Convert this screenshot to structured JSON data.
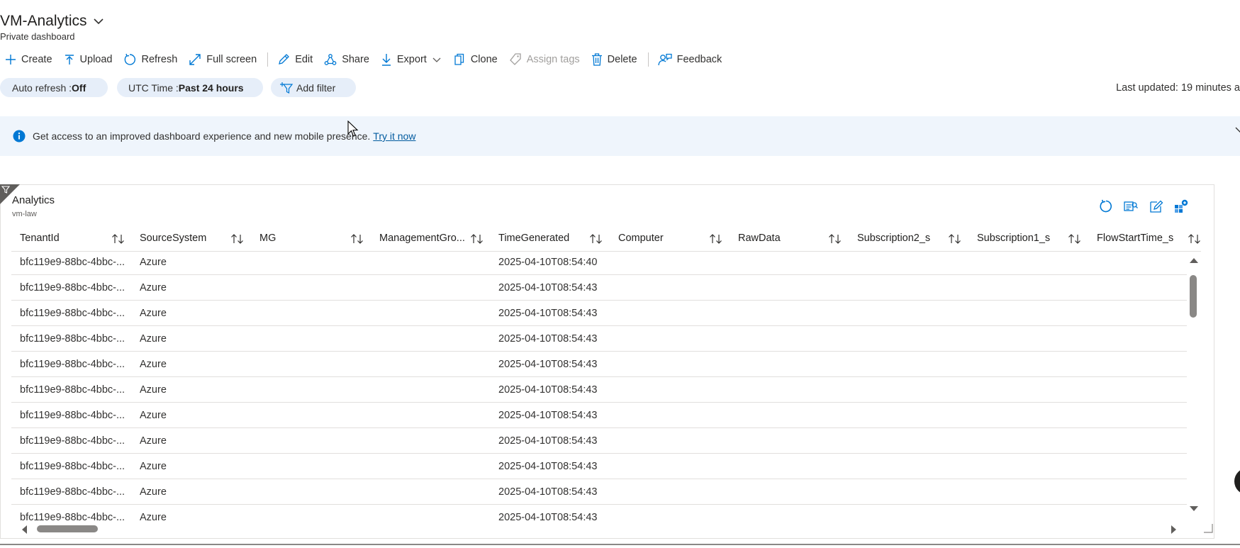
{
  "header": {
    "title": "VM-Analytics",
    "subtitle": "Private dashboard"
  },
  "toolbar": {
    "create": "Create",
    "upload": "Upload",
    "refresh": "Refresh",
    "full_screen": "Full screen",
    "edit": "Edit",
    "share": "Share",
    "export": "Export",
    "clone": "Clone",
    "assign_tags": "Assign tags",
    "delete": "Delete",
    "feedback": "Feedback"
  },
  "filters": {
    "auto_refresh_label": "Auto refresh : ",
    "auto_refresh_value": "Off",
    "time_label": "UTC Time : ",
    "time_value": "Past 24 hours",
    "add_filter": "Add filter",
    "last_updated": "Last updated: 19 minutes a"
  },
  "banner": {
    "message": "Get access to an improved dashboard experience and new mobile presence.",
    "link": "Try it now"
  },
  "tile": {
    "title": "Analytics",
    "subtitle": "vm-law"
  },
  "table": {
    "columns": [
      "TenantId",
      "SourceSystem",
      "MG",
      "ManagementGro...",
      "TimeGenerated",
      "Computer",
      "RawData",
      "Subscription2_s",
      "Subscription1_s",
      "FlowStartTime_s"
    ],
    "rows": [
      {
        "tenant": "bfc119e9-88bc-4bbc-...",
        "source": "Azure",
        "time": "2025-04-10T08:54:40"
      },
      {
        "tenant": "bfc119e9-88bc-4bbc-...",
        "source": "Azure",
        "time": "2025-04-10T08:54:43"
      },
      {
        "tenant": "bfc119e9-88bc-4bbc-...",
        "source": "Azure",
        "time": "2025-04-10T08:54:43"
      },
      {
        "tenant": "bfc119e9-88bc-4bbc-...",
        "source": "Azure",
        "time": "2025-04-10T08:54:43"
      },
      {
        "tenant": "bfc119e9-88bc-4bbc-...",
        "source": "Azure",
        "time": "2025-04-10T08:54:43"
      },
      {
        "tenant": "bfc119e9-88bc-4bbc-...",
        "source": "Azure",
        "time": "2025-04-10T08:54:43"
      },
      {
        "tenant": "bfc119e9-88bc-4bbc-...",
        "source": "Azure",
        "time": "2025-04-10T08:54:43"
      },
      {
        "tenant": "bfc119e9-88bc-4bbc-...",
        "source": "Azure",
        "time": "2025-04-10T08:54:43"
      },
      {
        "tenant": "bfc119e9-88bc-4bbc-...",
        "source": "Azure",
        "time": "2025-04-10T08:54:43"
      },
      {
        "tenant": "bfc119e9-88bc-4bbc-...",
        "source": "Azure",
        "time": "2025-04-10T08:54:43"
      },
      {
        "tenant": "bfc119e9-88bc-4bbc-...",
        "source": "Azure",
        "time": "2025-04-10T08:54:43"
      }
    ]
  },
  "colors": {
    "accent": "#0078d4",
    "pill_bg": "#e6eef9",
    "banner_bg": "#eff5fc"
  },
  "icons": [
    "chevron-down-icon",
    "plus-icon",
    "upload-icon",
    "refresh-icon",
    "full-screen-icon",
    "edit-icon",
    "share-icon",
    "export-icon",
    "clone-icon",
    "tag-icon",
    "delete-icon",
    "feedback-icon",
    "add-filter-icon",
    "info-icon",
    "close-icon",
    "filter-corner-icon",
    "tile-refresh-icon",
    "tile-query-icon",
    "tile-edit-icon",
    "pin-icon",
    "sort-icon",
    "mouse-cursor-icon"
  ]
}
